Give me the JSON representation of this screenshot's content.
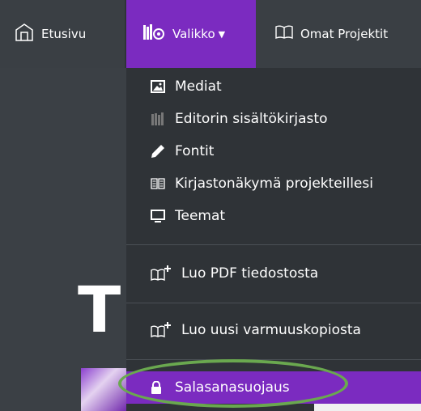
{
  "nav": {
    "home_label": "Etusivu",
    "menu_label": "Valikko",
    "projects_label": "Omat Projektit"
  },
  "page": {
    "heading_letter": "T"
  },
  "dropdown": {
    "items": [
      {
        "label": "Mediat",
        "icon": "image-icon"
      },
      {
        "label": "Editorin sisältökirjasto",
        "icon": "books-icon"
      },
      {
        "label": "Fontit",
        "icon": "pencil-icon"
      },
      {
        "label": "Kirjastonäkymä projekteillesi",
        "icon": "open-book-icon"
      },
      {
        "label": "Teemat",
        "icon": "monitor-icon"
      },
      {
        "label": "Luo PDF tiedostosta",
        "icon": "book-plus-icon"
      },
      {
        "label": "Luo uusi varmuuskopiosta",
        "icon": "book-plus-icon"
      },
      {
        "label": "Salasanasuojaus",
        "icon": "lock-icon"
      }
    ],
    "active_index": 7
  },
  "colors": {
    "accent": "#7b2bc0",
    "nav_bg": "#3a3f44",
    "dropdown_bg": "#2f3337",
    "ring": "#6aa84f"
  }
}
